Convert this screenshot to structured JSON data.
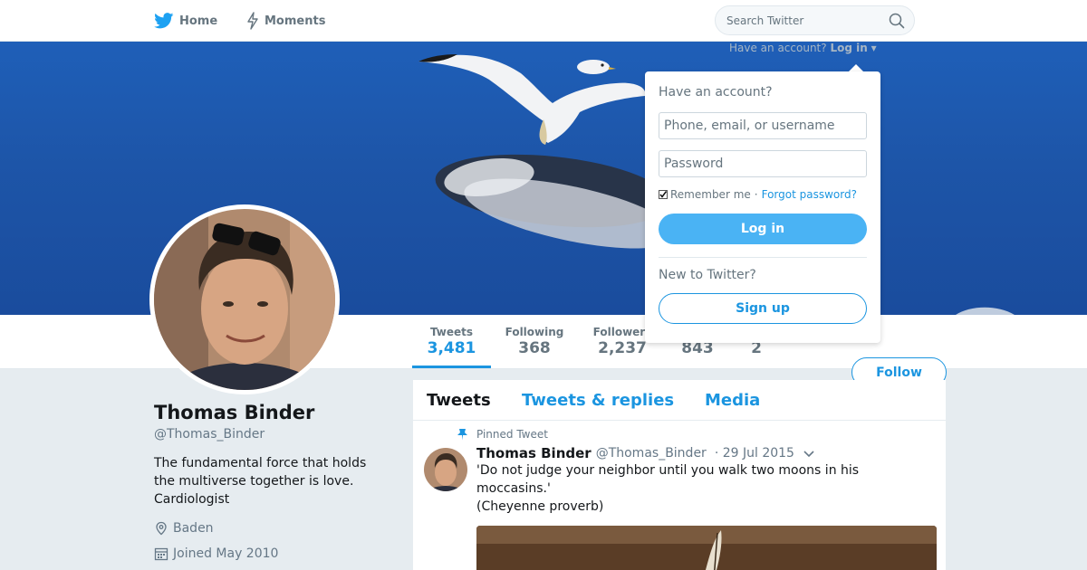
{
  "nav": {
    "home_label": "Home",
    "moments_label": "Moments",
    "search_placeholder": "Search Twitter"
  },
  "login_hint": {
    "text": "Have an account?",
    "link": "Log in"
  },
  "login_dropdown": {
    "title": "Have an account?",
    "username_placeholder": "Phone, email, or username",
    "password_placeholder": "Password",
    "remember_label": "Remember me",
    "separator": "·",
    "forgot_label": "Forgot password?",
    "login_button": "Log in",
    "new_label": "New to Twitter?",
    "signup_button": "Sign up"
  },
  "stats": [
    {
      "label": "Tweets",
      "value": "3,481",
      "active": true
    },
    {
      "label": "Following",
      "value": "368"
    },
    {
      "label": "Followers",
      "value": "2,237"
    },
    {
      "label": "",
      "value": "843"
    },
    {
      "label": "",
      "value": "2"
    }
  ],
  "follow_button": "Follow",
  "profile": {
    "name": "Thomas Binder",
    "handle": "@Thomas_Binder",
    "bio": "The fundamental force that holds the multiverse together is love. Cardiologist",
    "location": "Baden",
    "joined": "Joined May 2010"
  },
  "timeline": {
    "tabs": [
      "Tweets",
      "Tweets & replies",
      "Media"
    ],
    "pinned_label": "Pinned Tweet",
    "tweet": {
      "name": "Thomas Binder",
      "handle": "@Thomas_Binder",
      "date": "· 29 Jul 2015",
      "line1": "'Do not judge your neighbor until you walk two moons in his moccasins.'",
      "line2": "(Cheyenne proverb)"
    }
  },
  "colors": {
    "accent": "#1b95e0",
    "login_button": "#4ab3f4",
    "background": "#e6ecf0",
    "banner_sky": "#1d55a8"
  }
}
